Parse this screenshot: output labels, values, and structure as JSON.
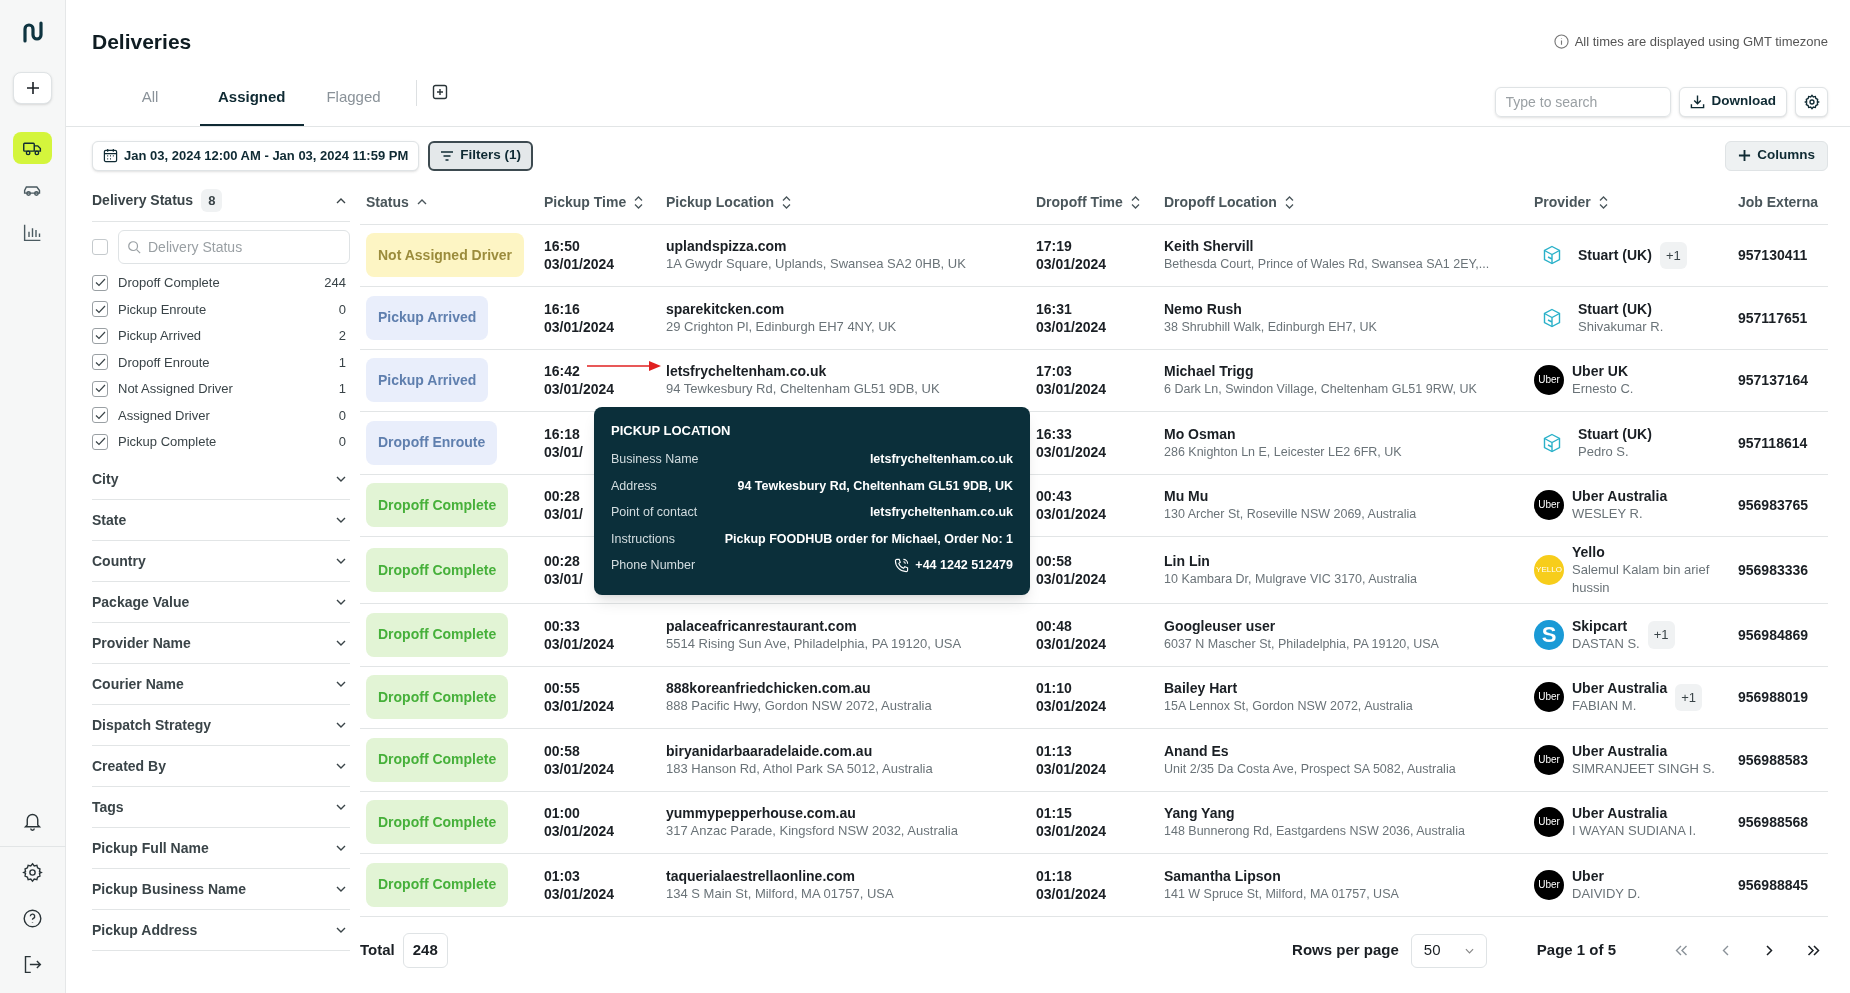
{
  "sidebar": {
    "nav": [
      {
        "kind": "deliveries",
        "selected": true
      },
      {
        "kind": "vehicles",
        "selected": false
      },
      {
        "kind": "analytics",
        "selected": false
      }
    ],
    "bottom": [
      {
        "kind": "notifications"
      },
      {
        "kind": "settings"
      },
      {
        "kind": "help"
      },
      {
        "kind": "logout"
      }
    ]
  },
  "header": {
    "title": "Deliveries",
    "timezone_note": "All times are displayed using GMT timezone"
  },
  "tabs": [
    {
      "label": "All",
      "selected": false
    },
    {
      "label": "Assigned",
      "selected": true
    },
    {
      "label": "Flagged",
      "selected": false
    }
  ],
  "toolbar": {
    "search_placeholder": "Type to search",
    "download_label": "Download",
    "date_range": "Jan 03, 2024 12:00 AM - Jan 03, 2024 11:59 PM",
    "filters_label": "Filters (1)",
    "columns_label": "Columns"
  },
  "filters": [
    {
      "label": "Delivery Status",
      "count": "8",
      "expanded": true,
      "all_checked": false,
      "search_placeholder": "Delivery Status",
      "options": [
        {
          "label": "Dropoff Complete",
          "count": "244",
          "checked": true
        },
        {
          "label": "Pickup Enroute",
          "count": "0",
          "checked": true
        },
        {
          "label": "Pickup Arrived",
          "count": "2",
          "checked": true
        },
        {
          "label": "Dropoff Enroute",
          "count": "1",
          "checked": true
        },
        {
          "label": "Not Assigned Driver",
          "count": "1",
          "checked": true
        },
        {
          "label": "Assigned Driver",
          "count": "0",
          "checked": true
        },
        {
          "label": "Pickup Complete",
          "count": "0",
          "checked": true
        }
      ]
    },
    {
      "label": "City",
      "expanded": false
    },
    {
      "label": "State",
      "expanded": false
    },
    {
      "label": "Country",
      "expanded": false
    },
    {
      "label": "Package Value",
      "expanded": false
    },
    {
      "label": "Provider Name",
      "expanded": false
    },
    {
      "label": "Courier Name",
      "expanded": false
    },
    {
      "label": "Dispatch Strategy",
      "expanded": false
    },
    {
      "label": "Created By",
      "expanded": false
    },
    {
      "label": "Tags",
      "expanded": false
    },
    {
      "label": "Pickup Full Name",
      "expanded": false
    },
    {
      "label": "Pickup Business Name",
      "expanded": false
    },
    {
      "label": "Pickup Address",
      "expanded": false
    }
  ],
  "table": {
    "columns": [
      {
        "label": "Status",
        "kind": "sorted"
      },
      {
        "label": "Pickup Time",
        "kind": "sortable"
      },
      {
        "label": "Pickup Location",
        "kind": "sortable"
      },
      {
        "label": "Dropoff Time",
        "kind": "sortable"
      },
      {
        "label": "Dropoff Location",
        "kind": "sortable"
      },
      {
        "label": "Provider",
        "kind": "sortable"
      },
      {
        "label": "Job Externa",
        "kind": "plain"
      }
    ],
    "rows": [
      {
        "status": {
          "label": "Not Assigned Driver",
          "kind": "not_assigned"
        },
        "pickup_time": "16:50",
        "pickup_date": "03/01/2024",
        "pickup_name": "uplandspizza.com",
        "pickup_address": "1A Gwydr Square, Uplands, Swansea SA2 0HB, UK",
        "dropoff_time": "17:19",
        "dropoff_date": "03/01/2024",
        "dropoff_name": "Keith Shervill",
        "dropoff_address": "Bethesda Court, Prince of Wales Rd, Swansea SA1 2EY,...",
        "provider": {
          "kind": "stuart",
          "name": "Stuart (UK)",
          "extra": "+1"
        },
        "job_id": "957130411",
        "arrow": false
      },
      {
        "status": {
          "label": "Pickup Arrived",
          "kind": "in_progress"
        },
        "pickup_time": "16:16",
        "pickup_date": "03/01/2024",
        "pickup_name": "sparekitcken.com",
        "pickup_address": "29 Crighton Pl, Edinburgh EH7 4NY, UK",
        "dropoff_time": "16:31",
        "dropoff_date": "03/01/2024",
        "dropoff_name": "Nemo Rush",
        "dropoff_address": "38 Shrubhill Walk, Edinburgh EH7, UK",
        "provider": {
          "kind": "stuart",
          "name": "Stuart (UK)",
          "courier": "Shivakumar R."
        },
        "job_id": "957117651",
        "arrow": false
      },
      {
        "status": {
          "label": "Pickup Arrived",
          "kind": "in_progress"
        },
        "pickup_time": "16:42",
        "pickup_date": "03/01/2024",
        "pickup_name": "letsfrycheltenham.co.uk",
        "pickup_address": "94 Tewkesbury Rd, Cheltenham GL51 9DB, UK",
        "dropoff_time": "17:03",
        "dropoff_date": "03/01/2024",
        "dropoff_name": "Michael Trigg",
        "dropoff_address": "6 Dark Ln, Swindon Village, Cheltenham GL51 9RW, UK",
        "provider": {
          "kind": "uber",
          "logo_text": "Uber",
          "name": "Uber UK",
          "courier": "Ernesto C."
        },
        "job_id": "957137164",
        "arrow": true
      },
      {
        "status": {
          "label": "Dropoff Enroute",
          "kind": "in_progress"
        },
        "pickup_time": "16:18",
        "pickup_date": "03/01/",
        "dropoff_time": "16:33",
        "dropoff_date": "03/01/2024",
        "dropoff_name": "Mo Osman",
        "dropoff_address": "286 Knighton Ln E, Leicester LE2 6FR, UK",
        "provider": {
          "kind": "stuart",
          "name": "Stuart (UK)",
          "courier": "Pedro S."
        },
        "job_id": "957118614",
        "arrow": false
      },
      {
        "status": {
          "label": "Dropoff Complete",
          "kind": "complete"
        },
        "pickup_time": "00:28",
        "pickup_date": "03/01/",
        "dropoff_time": "00:43",
        "dropoff_date": "03/01/2024",
        "dropoff_name": "Mu Mu",
        "dropoff_address": "130 Archer St, Roseville NSW 2069, Australia",
        "provider": {
          "kind": "uber",
          "logo_text": "Uber",
          "name": "Uber Australia",
          "courier": "WESLEY R."
        },
        "job_id": "956983765",
        "arrow": false
      },
      {
        "status": {
          "label": "Dropoff Complete",
          "kind": "complete"
        },
        "pickup_time": "00:28",
        "pickup_date": "03/01/",
        "dropoff_time": "00:58",
        "dropoff_date": "03/01/2024",
        "dropoff_name": "Lin Lin",
        "dropoff_address": "10 Kambara Dr, Mulgrave VIC 3170, Australia",
        "provider": {
          "kind": "yello",
          "logo_text": "YELLO",
          "name": "Yello",
          "courier": "Salemul Kalam bin arief hussin"
        },
        "job_id": "956983336",
        "arrow": false
      },
      {
        "status": {
          "label": "Dropoff Complete",
          "kind": "complete"
        },
        "pickup_time": "00:33",
        "pickup_date": "03/01/2024",
        "pickup_name": "palaceafricanrestaurant.com",
        "pickup_address": "5514 Rising Sun Ave, Philadelphia, PA 19120, USA",
        "dropoff_time": "00:48",
        "dropoff_date": "03/01/2024",
        "dropoff_name": "Googleuser user",
        "dropoff_address": "6037 N Mascher St, Philadelphia, PA 19120, USA",
        "provider": {
          "kind": "skipcart",
          "logo_text": "S",
          "name": "Skipcart",
          "courier": "DASTAN S.",
          "extra": "+1"
        },
        "job_id": "956984869",
        "arrow": false
      },
      {
        "status": {
          "label": "Dropoff Complete",
          "kind": "complete"
        },
        "pickup_time": "00:55",
        "pickup_date": "03/01/2024",
        "pickup_name": "888koreanfriedchicken.com.au",
        "pickup_address": "888 Pacific Hwy, Gordon NSW 2072, Australia",
        "dropoff_time": "01:10",
        "dropoff_date": "03/01/2024",
        "dropoff_name": "Bailey Hart",
        "dropoff_address": "15A Lennox St, Gordon NSW 2072, Australia",
        "provider": {
          "kind": "uber",
          "logo_text": "Uber",
          "name": "Uber Australia",
          "courier": "FABIAN M.",
          "extra": "+1"
        },
        "job_id": "956988019",
        "arrow": false
      },
      {
        "status": {
          "label": "Dropoff Complete",
          "kind": "complete"
        },
        "pickup_time": "00:58",
        "pickup_date": "03/01/2024",
        "pickup_name": "biryanidarbaaradelaide.com.au",
        "pickup_address": "183 Hanson Rd, Athol Park SA 5012, Australia",
        "dropoff_time": "01:13",
        "dropoff_date": "03/01/2024",
        "dropoff_name": "Anand Es",
        "dropoff_address": "Unit 2/35 Da Costa Ave, Prospect SA 5082, Australia",
        "provider": {
          "kind": "uber",
          "logo_text": "Uber",
          "name": "Uber Australia",
          "courier": "SIMRANJEET SINGH S."
        },
        "job_id": "956988583",
        "arrow": false
      },
      {
        "status": {
          "label": "Dropoff Complete",
          "kind": "complete"
        },
        "pickup_time": "01:00",
        "pickup_date": "03/01/2024",
        "pickup_name": "yummypepperhouse.com.au",
        "pickup_address": "317 Anzac Parade, Kingsford NSW 2032, Australia",
        "dropoff_time": "01:15",
        "dropoff_date": "03/01/2024",
        "dropoff_name": "Yang Yang",
        "dropoff_address": "148 Bunnerong Rd, Eastgardens NSW 2036, Australia",
        "provider": {
          "kind": "uber",
          "logo_text": "Uber",
          "name": "Uber Australia",
          "courier": "I WAYAN SUDIANA I."
        },
        "job_id": "956988568",
        "arrow": false
      },
      {
        "status": {
          "label": "Dropoff Complete",
          "kind": "complete"
        },
        "pickup_time": "01:03",
        "pickup_date": "03/01/2024",
        "pickup_name": "taquerialaestrellaonline.com",
        "pickup_address": "134 S Main St, Milford, MA 01757, USA",
        "dropoff_time": "01:18",
        "dropoff_date": "03/01/2024",
        "dropoff_name": "Samantha Lipson",
        "dropoff_address": "141 W Spruce St, Milford, MA 01757, USA",
        "provider": {
          "kind": "uber",
          "logo_text": "Uber",
          "name": "Uber",
          "courier": "DAIVIDY D."
        },
        "job_id": "956988845",
        "arrow": false
      }
    ]
  },
  "tooltip": {
    "title": "PICKUP LOCATION",
    "fields": [
      {
        "label": "Business Name",
        "value": "letsfrycheltenham.co.uk"
      },
      {
        "label": "Address",
        "value": "94 Tewkesbury Rd, Cheltenham GL51 9DB, UK"
      },
      {
        "label": "Point of contact",
        "value": "letsfrycheltenham.co.uk"
      },
      {
        "label": "Instructions",
        "value": "Pickup FOODHUB order for Michael, Order No: 1"
      },
      {
        "label": "Phone Number",
        "value": "+44 1242 512479",
        "kind": "phone"
      }
    ]
  },
  "footer": {
    "total_label": "Total",
    "total": "248",
    "rows_per_page_label": "Rows per page",
    "rows_per_page": "50",
    "page": "Page 1 of 5"
  }
}
